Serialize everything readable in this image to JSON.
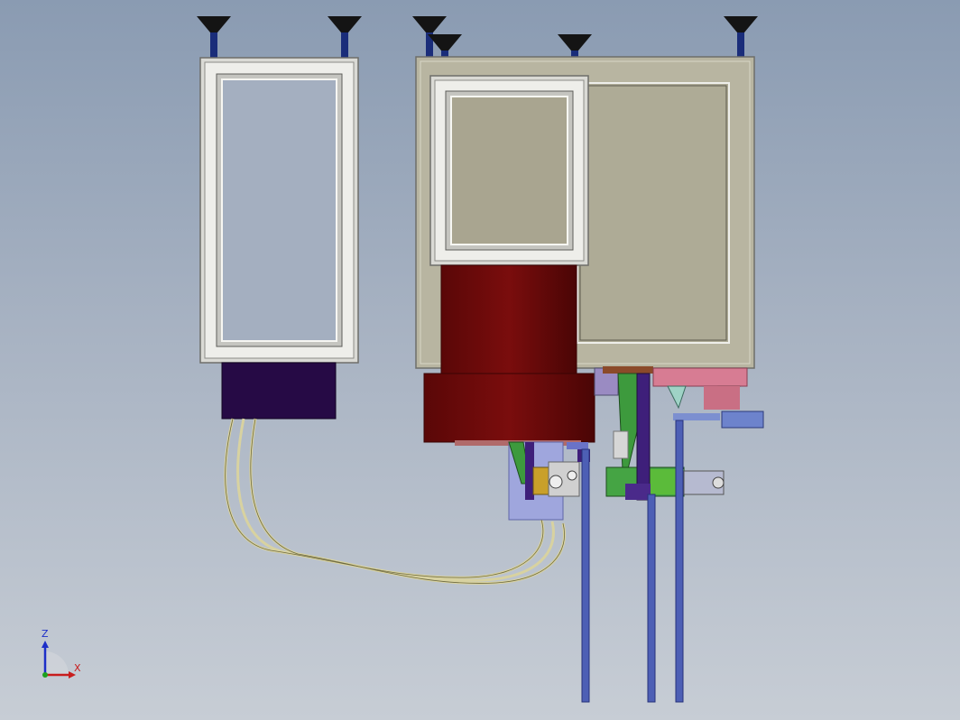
{
  "viewport": {
    "background_top": "#8a9bb2",
    "background_bottom": "#c7cdd5"
  },
  "colors": {
    "frame_light": "#f2f2ee",
    "frame_mid": "#c9c9c4",
    "frame_dark": "#7d7d78",
    "panel_beige": "#b8b5a1",
    "panel_beige_dark": "#a8a48f",
    "motor_red": "#6e0b0b",
    "motor_red_dark": "#4a0505",
    "controller_purple": "#260a45",
    "mount_black": "#141414",
    "stem_blue": "#1a2d7a",
    "rod_blue": "#4d5fb5",
    "cable_tan": "#d8d2a0",
    "cylinder_lavender": "#9fa6dd",
    "pink": "#d77c93",
    "green": "#45a444",
    "olive": "#8a8a20",
    "axis_x": "#c81d1d",
    "axis_y": "#1ea11e",
    "axis_z": "#1d2fc8"
  },
  "triad": {
    "x_label": "X",
    "z_label": "Z"
  }
}
